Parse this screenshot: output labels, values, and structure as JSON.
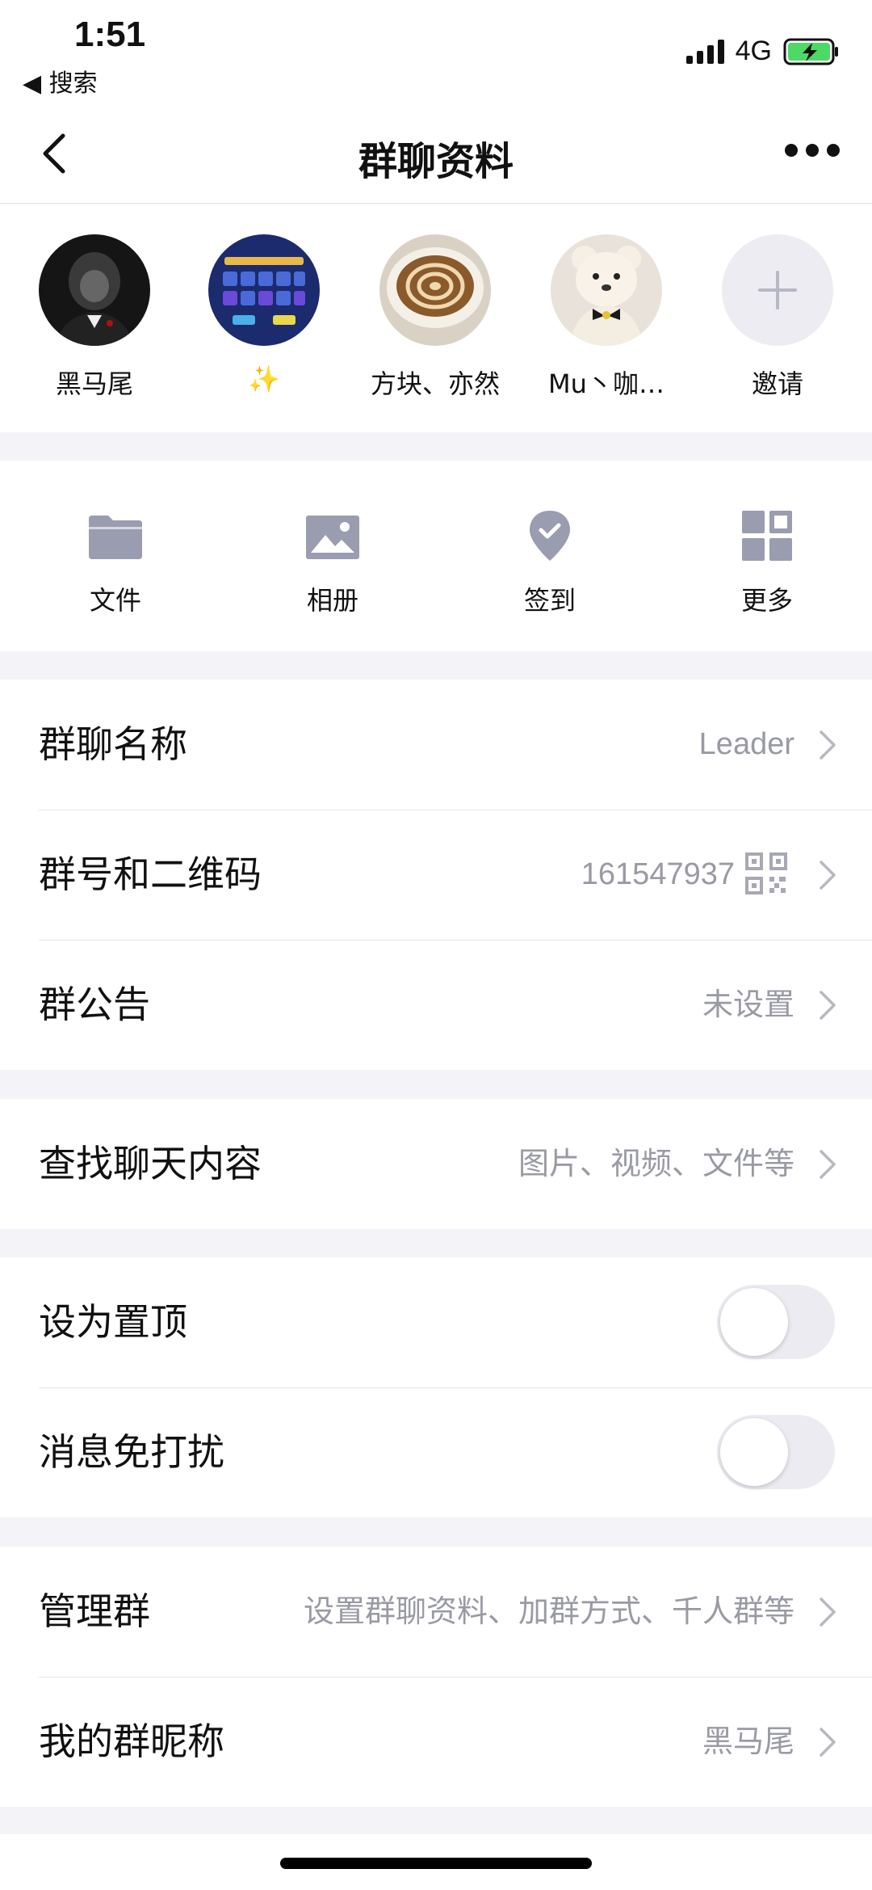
{
  "status_bar": {
    "time": "1:51",
    "back_app": "◀ 搜索",
    "network": "4G"
  },
  "nav": {
    "title": "群聊资料"
  },
  "members": [
    {
      "name": "黑马尾"
    },
    {
      "name": "✨"
    },
    {
      "name": "方块、亦然"
    },
    {
      "name": "Mu丶咖…"
    },
    {
      "name": "邀请"
    }
  ],
  "shortcuts": [
    {
      "label": "文件",
      "icon": "folder-icon"
    },
    {
      "label": "相册",
      "icon": "photo-icon"
    },
    {
      "label": "签到",
      "icon": "location-check-icon"
    },
    {
      "label": "更多",
      "icon": "grid-icon"
    }
  ],
  "group_info": {
    "name_label": "群聊名称",
    "name_value": "Leader",
    "id_label": "群号和二维码",
    "id_value": "161547937",
    "notice_label": "群公告",
    "notice_value": "未设置"
  },
  "search": {
    "label": "查找聊天内容",
    "value": "图片、视频、文件等"
  },
  "settings": {
    "pin_label": "设为置顶",
    "pin_on": false,
    "mute_label": "消息免打扰",
    "mute_on": false
  },
  "manage": {
    "manage_label": "管理群",
    "manage_value": "设置群聊资料、加群方式、千人群等",
    "nickname_label": "我的群昵称",
    "nickname_value": "黑马尾"
  },
  "colors": {
    "icon_gray": "#9a9cb0",
    "secondary_text": "#999aa3",
    "toggle_off": "#ebebf1"
  }
}
